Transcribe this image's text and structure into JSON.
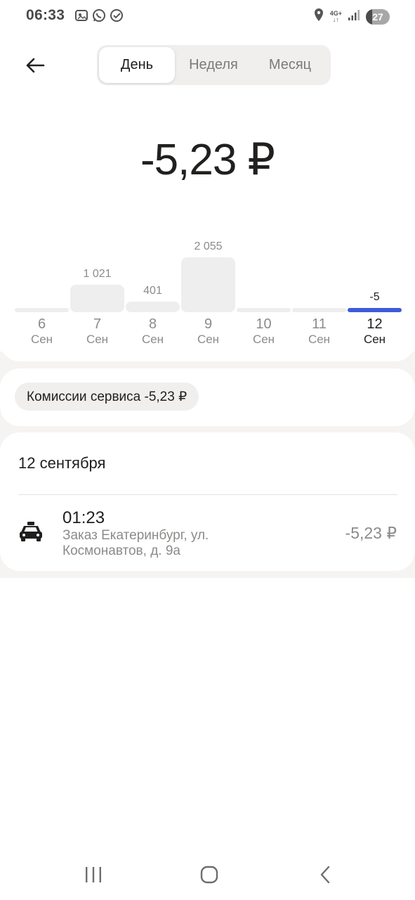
{
  "status_bar": {
    "time": "06:33",
    "network": "4G+",
    "battery": "27",
    "icons": [
      "gallery-icon",
      "whatsapp-icon",
      "check-circle-icon",
      "location-icon",
      "signal-icon"
    ]
  },
  "header": {
    "back_icon": "arrow-left-icon",
    "tabs": [
      {
        "label": "День",
        "active": true
      },
      {
        "label": "Неделя",
        "active": false
      },
      {
        "label": "Месяц",
        "active": false
      }
    ]
  },
  "total": "-5,23 ₽",
  "chart_data": {
    "type": "bar",
    "categories": [
      "6 Сен",
      "7 Сен",
      "8 Сен",
      "9 Сен",
      "10 Сен",
      "11 Сен",
      "12 Сен"
    ],
    "days": [
      {
        "day": "6",
        "month": "Сен",
        "label": "",
        "value": 0,
        "selected": false
      },
      {
        "day": "7",
        "month": "Сен",
        "label": "1 021",
        "value": 1021,
        "selected": false
      },
      {
        "day": "8",
        "month": "Сен",
        "label": "401",
        "value": 401,
        "selected": false
      },
      {
        "day": "9",
        "month": "Сен",
        "label": "2 055",
        "value": 2055,
        "selected": false
      },
      {
        "day": "10",
        "month": "Сен",
        "label": "",
        "value": 0,
        "selected": false
      },
      {
        "day": "11",
        "month": "Сен",
        "label": "",
        "value": 0,
        "selected": false
      },
      {
        "day": "12",
        "month": "Сен",
        "label": "-5",
        "value": -5,
        "selected": true
      }
    ],
    "selected_color": "#3d5bd9",
    "bar_color": "#eeeeee"
  },
  "commission_chip": "Комиссии сервиса -5,23 ₽",
  "orders": {
    "date_header": "12 сентября",
    "items": [
      {
        "icon": "taxi-icon",
        "time": "01:23",
        "address": "Заказ Екатеринбург, ул. Космонавтов, д. 9а",
        "amount": "-5,23 ₽"
      }
    ]
  },
  "nav_bar": {
    "icons": [
      "recent-apps-icon",
      "home-icon",
      "back-icon"
    ]
  }
}
